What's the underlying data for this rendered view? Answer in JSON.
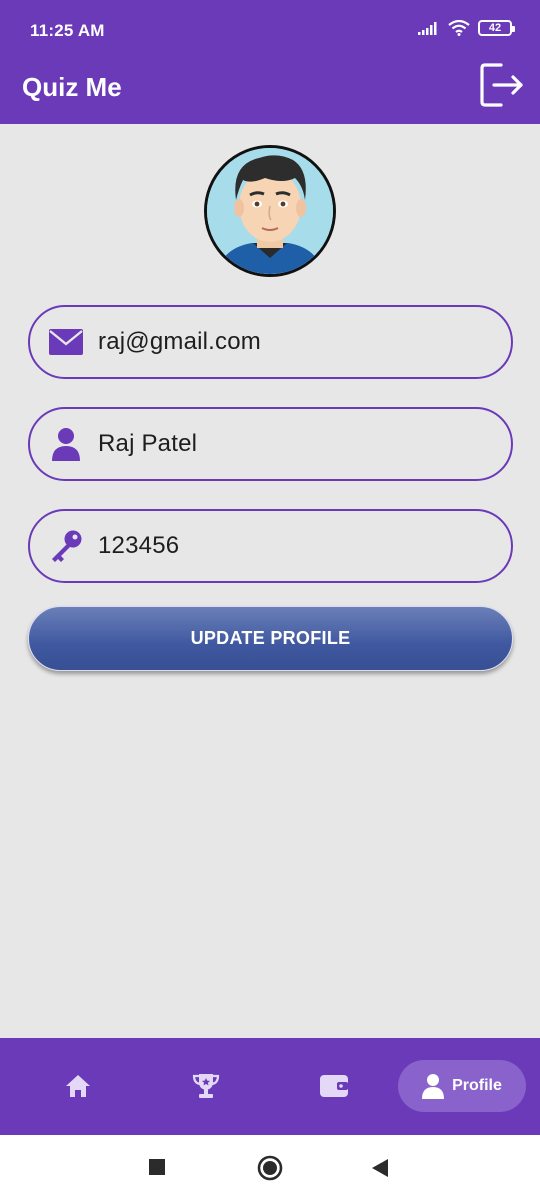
{
  "status_bar": {
    "time": "11:25 AM",
    "battery_level": "42",
    "icons": [
      "signal-icon",
      "wifi-icon",
      "battery-icon"
    ]
  },
  "app_bar": {
    "title": "Quiz Me",
    "action_icon": "logout-icon"
  },
  "profile": {
    "avatar_icon": "user-avatar",
    "email": {
      "icon": "envelope-icon",
      "value": "raj@gmail.com"
    },
    "name": {
      "icon": "person-icon",
      "value": "Raj Patel"
    },
    "password": {
      "icon": "key-icon",
      "value": "123456"
    },
    "update_button_label": "UPDATE PROFILE"
  },
  "bottom_nav": {
    "items": [
      {
        "icon": "home-icon",
        "label": "",
        "active": false
      },
      {
        "icon": "trophy-icon",
        "label": "",
        "active": false
      },
      {
        "icon": "wallet-icon",
        "label": "",
        "active": false
      },
      {
        "icon": "person-icon",
        "label": "Profile",
        "active": true
      }
    ]
  },
  "colors": {
    "primary": "#6a3ab8",
    "active_pill": "#8a62cc",
    "button": "#3f58a0",
    "background": "#e7e7e7"
  }
}
